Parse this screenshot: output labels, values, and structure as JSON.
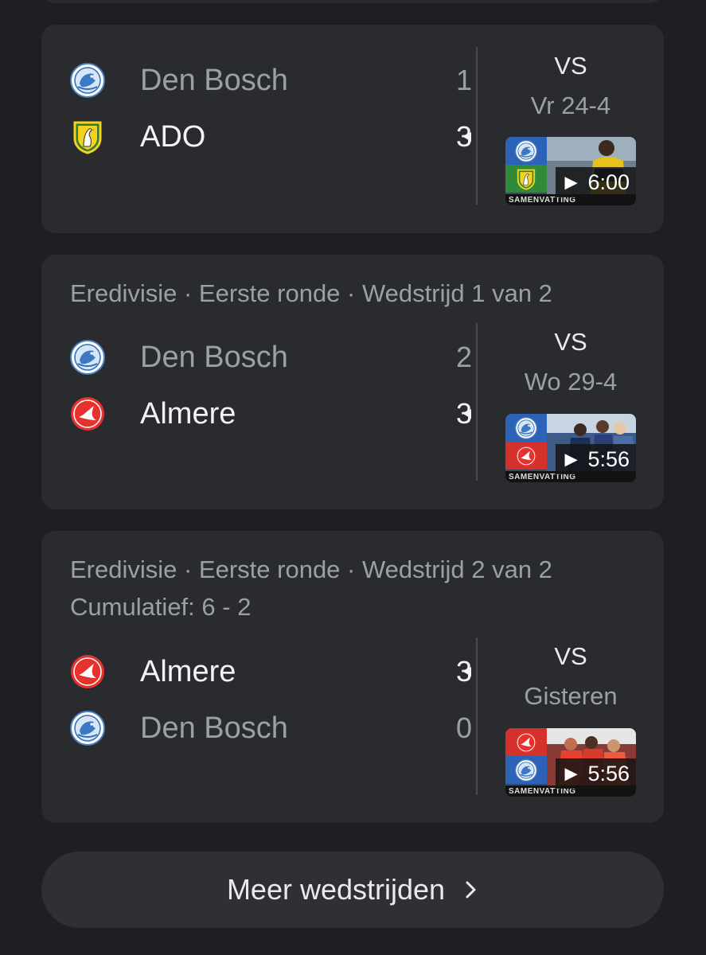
{
  "matches": [
    {
      "meta": "",
      "teams": [
        {
          "name": "Den Bosch",
          "score": "1",
          "crest": "den-bosch"
        },
        {
          "name": "ADO",
          "score": "3",
          "crest": "ado"
        }
      ],
      "vs": "VS",
      "date": "Vr 24-4",
      "video": {
        "duration": "► 6:00",
        "caption": "SAMENVATTING"
      }
    },
    {
      "meta": "Eredivisie · Eerste ronde · Wedstrijd 1 van 2",
      "teams": [
        {
          "name": "Den Bosch",
          "score": "2",
          "crest": "den-bosch"
        },
        {
          "name": "Almere",
          "score": "3",
          "crest": "almere"
        }
      ],
      "vs": "VS",
      "date": "Wo 29-4",
      "video": {
        "duration": "► 5:56",
        "caption": "SAMENVATTING"
      }
    },
    {
      "meta": "Eredivisie · Eerste ronde · Wedstrijd 2 van 2",
      "meta2": "Cumulatief: 6 - 2",
      "teams": [
        {
          "name": "Almere",
          "score": "3",
          "crest": "almere"
        },
        {
          "name": "Den Bosch",
          "score": "0",
          "crest": "den-bosch"
        }
      ],
      "vs": "VS",
      "date": "Gisteren",
      "video": {
        "duration": "► 5:56",
        "caption": "SAMENVATTING"
      }
    }
  ],
  "more_button": {
    "label": "Meer wedstrijden",
    "icon": "chevron-right-icon"
  },
  "colors": {
    "background": "#1f1f23",
    "card": "#2a2b2f",
    "muted": "#9aa0a6",
    "text": "#f1f3f4"
  }
}
